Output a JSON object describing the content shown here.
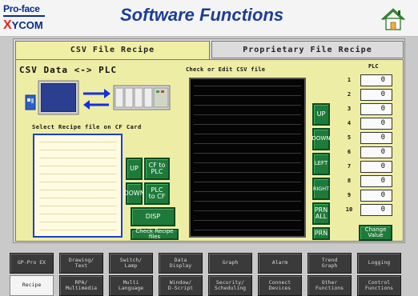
{
  "header": {
    "logo_line1": "Pro-face",
    "logo_line2_x": "X",
    "logo_line2_rest": "YCOM",
    "title": "Software Functions",
    "home_icon": "home-icon"
  },
  "tabs": [
    {
      "label": "CSV File Recipe",
      "active": true
    },
    {
      "label": "Proprietary File Recipe",
      "active": false
    }
  ],
  "left": {
    "title": "CSV Data <-> PLC",
    "select_label": "Select Recipe file on CF Card",
    "buttons": {
      "up": "UP",
      "down": "DOWN",
      "cf_to_plc_1": "CF to",
      "cf_to_plc_2": "PLC",
      "plc_to_cf_1": "PLC",
      "plc_to_cf_2": "to CF",
      "disp": "DISP",
      "check_1": "Check",
      "check_2": "Recipe files"
    }
  },
  "editor": {
    "label": "Check or Edit CSV file",
    "buttons": {
      "up": "UP",
      "down": "DOWN",
      "left": "LEFT",
      "right": "RIGHT",
      "prn_all_1": "PRN",
      "prn_all_2": "ALL",
      "prn": "PRN"
    }
  },
  "plc": {
    "label": "PLC",
    "rows": [
      {
        "n": "1",
        "v": "0"
      },
      {
        "n": "2",
        "v": "0"
      },
      {
        "n": "3",
        "v": "0"
      },
      {
        "n": "4",
        "v": "0"
      },
      {
        "n": "5",
        "v": "0"
      },
      {
        "n": "6",
        "v": "0"
      },
      {
        "n": "7",
        "v": "0"
      },
      {
        "n": "8",
        "v": "0"
      },
      {
        "n": "9",
        "v": "0"
      },
      {
        "n": "10",
        "v": "0"
      }
    ],
    "change_1": "Change",
    "change_2": "Value"
  },
  "nav": {
    "row1": [
      {
        "l1": "GP-Pro EX",
        "l2": ""
      },
      {
        "l1": "Drawing/",
        "l2": "Text"
      },
      {
        "l1": "Switch/",
        "l2": "Lamp"
      },
      {
        "l1": "Data",
        "l2": "Display"
      },
      {
        "l1": "Graph",
        "l2": ""
      },
      {
        "l1": "Alarm",
        "l2": ""
      },
      {
        "l1": "Trend",
        "l2": "Graph"
      },
      {
        "l1": "Logging",
        "l2": ""
      }
    ],
    "row2": [
      {
        "l1": "Recipe",
        "l2": "",
        "active": true
      },
      {
        "l1": "RPA/",
        "l2": "Multimedia"
      },
      {
        "l1": "Multi",
        "l2": "Language"
      },
      {
        "l1": "Window/",
        "l2": "D-Script"
      },
      {
        "l1": "Security/",
        "l2": "Scheduling"
      },
      {
        "l1": "Connect",
        "l2": "Devices"
      },
      {
        "l1": "Other",
        "l2": "Functions"
      },
      {
        "l1": "Control",
        "l2": "Functions"
      }
    ]
  }
}
